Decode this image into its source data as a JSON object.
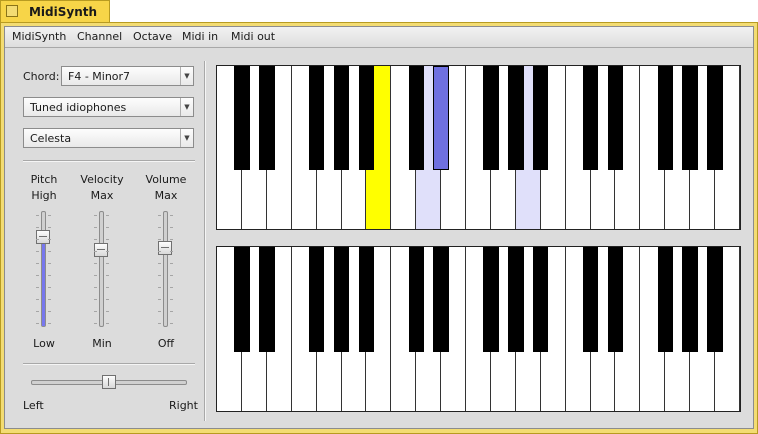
{
  "window": {
    "title": "MidiSynth"
  },
  "menu": [
    "MidiSynth",
    "Channel",
    "Octave",
    "Midi in",
    "Midi out"
  ],
  "controls": {
    "chord_label": "Chord:",
    "chord_value": "F4 - Minor7",
    "instrument_group": "Tuned idiophones",
    "instrument": "Celesta"
  },
  "sliders": [
    {
      "label": "Pitch",
      "top": "High",
      "bottom": "Low",
      "value": 0.78,
      "filled": true
    },
    {
      "label": "Velocity",
      "top": "Max",
      "bottom": "Min",
      "value": 0.66,
      "filled": false
    },
    {
      "label": "Volume",
      "top": "Max",
      "bottom": "Off",
      "value": 0.68,
      "filled": false
    }
  ],
  "balance": {
    "left": "Left",
    "right": "Right",
    "value": 0.5
  },
  "colors": {
    "chord_root": "#ffff00",
    "chord_note_white": "#e0e0fa",
    "chord_note_black": "#6f70e0",
    "slider_fill": "#7777ee",
    "window_tab": "#f7d548"
  },
  "keyboards": {
    "upper": {
      "white_keys": 21,
      "highlight_white": {
        "6": "chord_root",
        "8": "chord_note_white",
        "12": "chord_note_white"
      },
      "highlight_black": {
        "8": "chord_note_black"
      }
    },
    "lower": {
      "white_keys": 21,
      "highlight_white": {},
      "highlight_black": {}
    }
  }
}
